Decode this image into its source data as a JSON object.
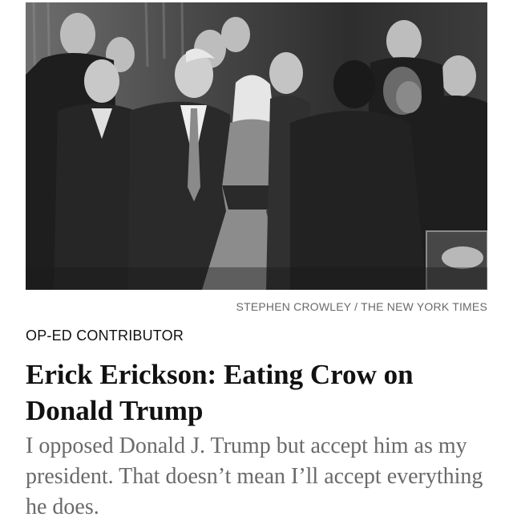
{
  "article": {
    "photo_credit": "STEPHEN CROWLEY / THE NEW YORK TIMES",
    "kicker": "OP-ED CONTRIBUTOR",
    "headline": "Erick Erickson: Eating Crow on Donald Trump",
    "summary": "I opposed Donald J. Trump but accept him as my president. That doesn’t mean I’ll accept everything he does."
  },
  "photo": {
    "style": "black-and-white",
    "subject": "group-of-people-on-stage"
  }
}
